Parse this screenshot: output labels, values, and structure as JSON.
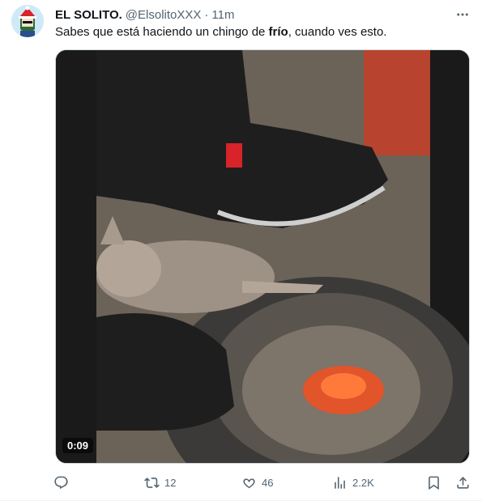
{
  "post": {
    "author_name": "EL SOLITO.",
    "handle": "@ElsolitoXXX",
    "separator": "·",
    "time": "11m",
    "text_before": "Sabes que está haciendo un chingo de ",
    "text_bold": "frío",
    "text_after": ", cuando ves esto.",
    "media_duration": "0:09"
  },
  "actions": {
    "reply_count": "",
    "retweet_count": "12",
    "like_count": "46",
    "views_count": "2.2K"
  },
  "icons": {
    "avatar": "avatar-icon",
    "more": "more-icon",
    "reply": "reply-icon",
    "retweet": "retweet-icon",
    "like": "heart-icon",
    "views": "views-icon",
    "bookmark": "bookmark-icon",
    "share": "share-icon"
  },
  "colors": {
    "text_primary": "#0f1419",
    "text_secondary": "#536471",
    "border": "#cfd9de"
  }
}
